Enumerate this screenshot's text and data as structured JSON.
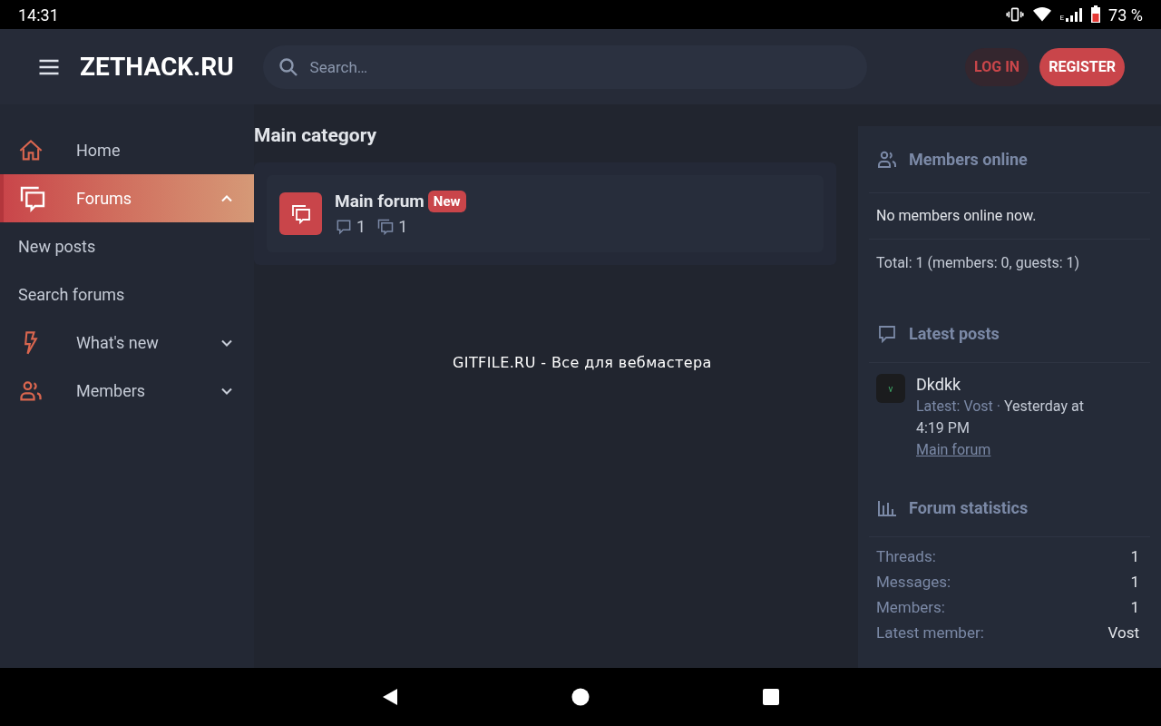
{
  "status_bar": {
    "time": "14:31",
    "network_label": "E",
    "battery": "73 %"
  },
  "header": {
    "logo": "ZETHACK.RU",
    "search": {
      "placeholder": "Search…"
    },
    "login": "LOG IN",
    "register": "REGISTER"
  },
  "sidebar": {
    "items": [
      {
        "kind": "home",
        "label": "Home",
        "selected": false
      },
      {
        "kind": "forums",
        "label": "Forums",
        "selected": true,
        "expanded": true,
        "children": [
          {
            "label": "New posts"
          },
          {
            "label": "Search forums"
          }
        ]
      },
      {
        "kind": "bolt",
        "label": "What's new",
        "selected": false,
        "expanded": false
      },
      {
        "kind": "members",
        "label": "Members",
        "selected": false,
        "expanded": false
      }
    ]
  },
  "main": {
    "category_title": "Main category",
    "forums": [
      {
        "title": "Main forum",
        "badge": "New",
        "threads": "1",
        "messages": "1"
      }
    ],
    "footer_text": "GITFILE.RU - Все для вебмастера"
  },
  "widgets": {
    "members_online": {
      "title": "Members online",
      "message": "No members online now.",
      "total": "Total: 1 (members: 0, guests: 1)"
    },
    "latest_posts": {
      "title": "Latest posts",
      "posts": [
        {
          "avatar_letter": "v",
          "title": "Dkdkk",
          "latest": "Latest: Vost",
          "separator": "·",
          "time": "Yesterday at 4:19 PM",
          "forum": "Main forum"
        }
      ]
    },
    "forum_statistics": {
      "title": "Forum statistics",
      "rows": [
        {
          "label": "Threads:",
          "value": "1"
        },
        {
          "label": "Messages:",
          "value": "1"
        },
        {
          "label": "Members:",
          "value": "1"
        },
        {
          "label": "Latest member:",
          "value": "Vost"
        }
      ]
    }
  }
}
